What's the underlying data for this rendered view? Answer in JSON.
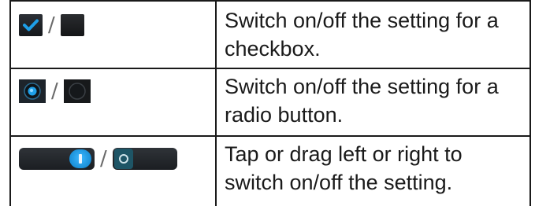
{
  "rows": [
    {
      "icon_pair": [
        "checkbox-checked-icon",
        "checkbox-unchecked-icon"
      ],
      "separator": "/",
      "text": "Switch on/off the setting for a checkbox."
    },
    {
      "icon_pair": [
        "radio-selected-icon",
        "radio-unselected-icon"
      ],
      "separator": "/",
      "text": "Switch on/off the setting for a radio button."
    },
    {
      "icon_pair": [
        "toggle-on-icon",
        "toggle-off-icon"
      ],
      "separator": "/",
      "text": "Tap or drag left or right to switch on/off the setting."
    }
  ],
  "colors": {
    "accent_blue": "#1E9FE8",
    "control_dark": "#1D2227",
    "border": "#1A1A1A"
  }
}
